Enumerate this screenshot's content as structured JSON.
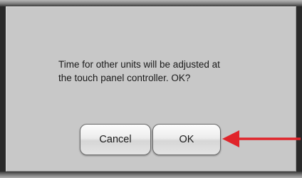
{
  "dialog": {
    "message_line1": "Time for other units will be adjusted at",
    "message_line2": "the touch panel controller. OK?",
    "cancel_label": "Cancel",
    "ok_label": "OK"
  },
  "annotation": {
    "arrow_icon": "red-arrow-left",
    "arrow_color": "#e0242a"
  },
  "colors": {
    "panel_background": "#c8c8c8",
    "frame": "#2a2a2a"
  }
}
